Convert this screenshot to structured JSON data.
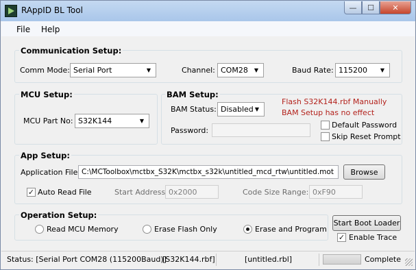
{
  "window": {
    "title": "RAppID BL Tool",
    "min_glyph": "—",
    "max_glyph": "☐",
    "close_glyph": "✕"
  },
  "menu": {
    "file": "File",
    "help": "Help"
  },
  "comm": {
    "title": "Communication Setup:",
    "mode_label": "Comm Mode:",
    "mode_value": "Serial Port",
    "channel_label": "Channel:",
    "channel_value": "COM28",
    "baud_label": "Baud Rate:",
    "baud_value": "115200"
  },
  "mcu": {
    "title": "MCU Setup:",
    "part_label": "MCU Part No:",
    "part_value": "S32K144"
  },
  "bam": {
    "title": "BAM Setup:",
    "status_label": "BAM Status:",
    "status_value": "Disabled",
    "password_label": "Password:",
    "password_value": "",
    "note_line1": "Flash S32K144.rbf Manually",
    "note_line2": "BAM Setup has no effect",
    "default_password_label": "Default Password",
    "default_password_checked": false,
    "skip_reset_label": "Skip Reset Prompt",
    "skip_reset_checked": false
  },
  "app": {
    "title": "App Setup:",
    "file_label": "Application File:",
    "file_value": "C:\\MCToolbox\\mctbx_S32K\\mctbx_s32k\\untitled_mcd_rtw\\untitled.mot",
    "browse_label": "Browse",
    "auto_read_label": "Auto Read File",
    "auto_read_checked": true,
    "start_address_label": "Start Address:",
    "start_address_value": "0x2000",
    "code_size_label": "Code Size Range:",
    "code_size_value": "0xF90"
  },
  "op": {
    "title": "Operation Setup:",
    "options": [
      {
        "label": "Read MCU Memory",
        "selected": false
      },
      {
        "label": "Erase Flash Only",
        "selected": false
      },
      {
        "label": "Erase and Program",
        "selected": true
      }
    ],
    "start_label": "Start Boot Loader",
    "trace_label": "Enable Trace",
    "trace_checked": true
  },
  "status": {
    "connection": "Status: [Serial Port COM28 (115200Baud)]",
    "rbf": "[S32K144.rbf]",
    "rbl": "[untitled.rbl]",
    "progress": 0,
    "state": "Complete"
  },
  "icons": {
    "dropdown": "chevron-down-icon",
    "check": "checkmark-icon"
  }
}
